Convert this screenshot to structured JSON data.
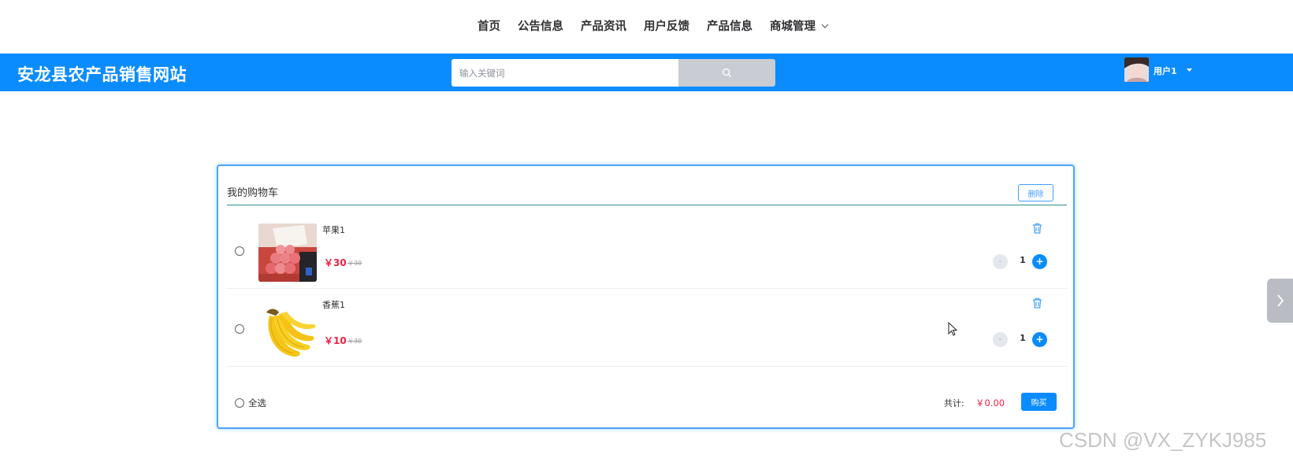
{
  "nav": {
    "items": [
      "首页",
      "公告信息",
      "产品资讯",
      "用户反馈",
      "产品信息",
      "商城管理"
    ]
  },
  "header": {
    "site_title": "安龙县农产品销售网站",
    "search_placeholder": "输入关键词",
    "user_name": "用户1",
    "bg_color": "#0a8cff"
  },
  "cart": {
    "title": "我的购物车",
    "delete_label": "删除",
    "items": [
      {
        "name": "苹果1",
        "price": "￥30",
        "original_price": "￥30",
        "quantity": "1",
        "minus_label": "-",
        "plus_label": "+"
      },
      {
        "name": "香蕉1",
        "price": "￥10",
        "original_price": "￥30",
        "quantity": "1",
        "minus_label": "-",
        "plus_label": "+"
      }
    ],
    "select_all_label": "全选",
    "total_label": "共计:",
    "total_value": "￥0.00",
    "buy_label": "购买"
  },
  "watermark": "CSDN @VX_ZYKJ985",
  "icons": {
    "search": "search-icon",
    "trash": "trash-icon",
    "side_tab": "chevron-right-icon",
    "nav_dropdown": "chevron-down-icon",
    "user_dropdown": "caret-down-icon"
  }
}
